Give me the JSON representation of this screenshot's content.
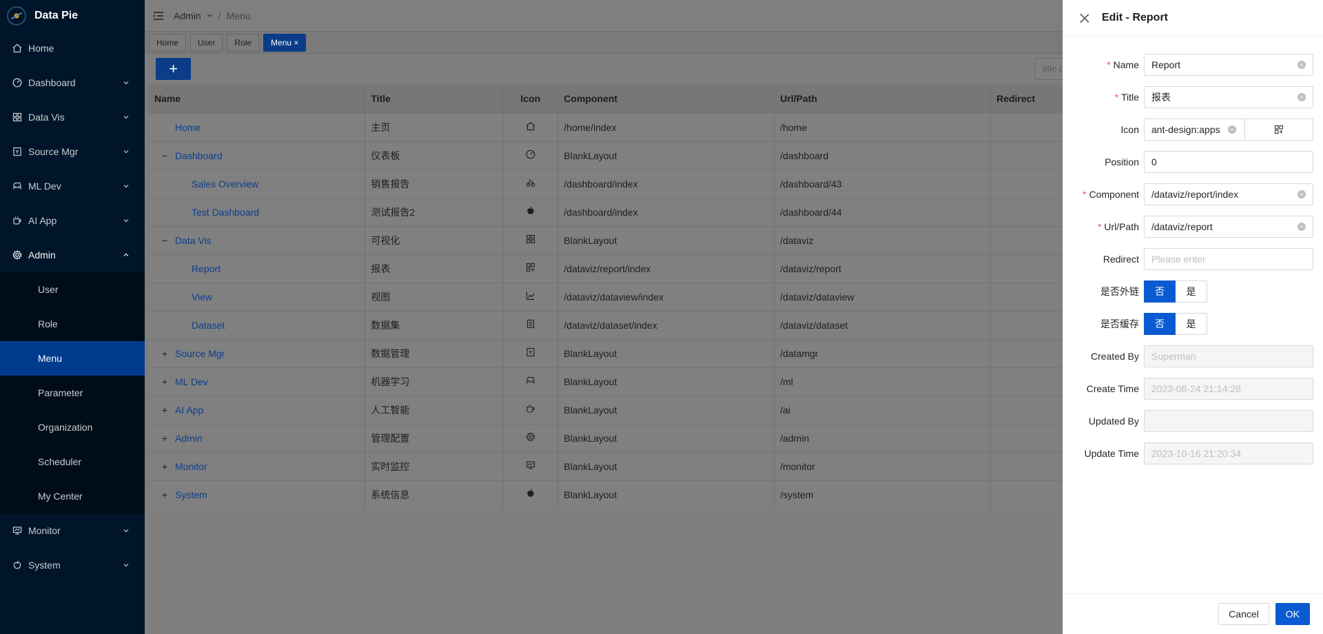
{
  "app": {
    "name": "Data Pie"
  },
  "sidebar": {
    "items": [
      {
        "label": "Home",
        "icon": "home-icon"
      },
      {
        "label": "Dashboard",
        "icon": "dashboard-icon"
      },
      {
        "label": "Data Vis",
        "icon": "grid-icon"
      },
      {
        "label": "Source Mgr",
        "icon": "database-icon"
      },
      {
        "label": "ML Dev",
        "icon": "car-icon"
      },
      {
        "label": "AI App",
        "icon": "cup-icon"
      },
      {
        "label": "Admin",
        "icon": "gear-icon"
      },
      {
        "label": "Monitor",
        "icon": "monitor-icon"
      },
      {
        "label": "System",
        "icon": "apple-icon"
      }
    ],
    "admin_sub": [
      "User",
      "Role",
      "Menu",
      "Parameter",
      "Organization",
      "Scheduler",
      "My Center"
    ]
  },
  "breadcrumb": {
    "first": "Admin",
    "sep": "/",
    "last": "Menu"
  },
  "tabs": [
    "Home",
    "User",
    "Role",
    "Menu ×"
  ],
  "toolbar": {
    "add_label": "+",
    "search_placeholder": "title o"
  },
  "table": {
    "columns": [
      "Name",
      "Title",
      "Icon",
      "Component",
      "Url/Path",
      "Redirect"
    ],
    "rows": [
      {
        "expander": "",
        "level": 0,
        "name": "Home",
        "title": "主页",
        "icon": "home-icon",
        "component": "/home/index",
        "path": "/home"
      },
      {
        "expander": "−",
        "level": 0,
        "name": "Dashboard",
        "title": "仪表板",
        "icon": "dashboard-icon",
        "component": "BlankLayout",
        "path": "/dashboard"
      },
      {
        "expander": "",
        "level": 1,
        "name": "Sales Overview",
        "title": "销售报告",
        "icon": "bike-icon",
        "component": "/dashboard/index",
        "path": "/dashboard/43"
      },
      {
        "expander": "",
        "level": 1,
        "name": "Test Dashboard",
        "title": "测试报告2",
        "icon": "apple-icon",
        "component": "/dashboard/index",
        "path": "/dashboard/44"
      },
      {
        "expander": "−",
        "level": 0,
        "name": "Data Vis",
        "title": "可视化",
        "icon": "grid-icon",
        "component": "BlankLayout",
        "path": "/dataviz"
      },
      {
        "expander": "",
        "level": 1,
        "name": "Report",
        "title": "报表",
        "icon": "apps-icon",
        "component": "/dataviz/report/index",
        "path": "/dataviz/report"
      },
      {
        "expander": "",
        "level": 1,
        "name": "View",
        "title": "视图",
        "icon": "line-chart-icon",
        "component": "/dataviz/dataview/index",
        "path": "/dataviz/dataview"
      },
      {
        "expander": "",
        "level": 1,
        "name": "Dataset",
        "title": "数据集",
        "icon": "document-icon",
        "component": "/dataviz/dataset/index",
        "path": "/dataviz/dataset"
      },
      {
        "expander": "+",
        "level": 0,
        "name": "Source Mgr",
        "title": "数据管理",
        "icon": "database-icon",
        "component": "BlankLayout",
        "path": "/datamgr"
      },
      {
        "expander": "+",
        "level": 0,
        "name": "ML Dev",
        "title": "机器学习",
        "icon": "car-icon",
        "component": "BlankLayout",
        "path": "/ml"
      },
      {
        "expander": "+",
        "level": 0,
        "name": "AI App",
        "title": "人工智能",
        "icon": "cup-icon",
        "component": "BlankLayout",
        "path": "/ai"
      },
      {
        "expander": "+",
        "level": 0,
        "name": "Admin",
        "title": "管理配置",
        "icon": "gear-icon",
        "component": "BlankLayout",
        "path": "/admin"
      },
      {
        "expander": "+",
        "level": 0,
        "name": "Monitor",
        "title": "实时监控",
        "icon": "monitor-icon",
        "component": "BlankLayout",
        "path": "/monitor"
      },
      {
        "expander": "+",
        "level": 0,
        "name": "System",
        "title": "系统信息",
        "icon": "apple-icon",
        "component": "BlankLayout",
        "path": "/system"
      }
    ]
  },
  "drawer": {
    "title": "Edit - Report",
    "fields": {
      "name": {
        "label": "Name",
        "value": "Report"
      },
      "title": {
        "label": "Title",
        "value": "报表"
      },
      "icon": {
        "label": "Icon",
        "value": "ant-design:apps"
      },
      "position": {
        "label": "Position",
        "value": "0"
      },
      "component": {
        "label": "Component",
        "value": "/dataviz/report/index"
      },
      "path": {
        "label": "Url/Path",
        "value": "/dataviz/report"
      },
      "redirect": {
        "label": "Redirect",
        "placeholder": "Please enter"
      },
      "external": {
        "label": "是否外链",
        "options": [
          "否",
          "是"
        ]
      },
      "cache": {
        "label": "是否缓存",
        "options": [
          "否",
          "是"
        ]
      },
      "created_by": {
        "label": "Created By",
        "value": "Superman"
      },
      "create_time": {
        "label": "Create Time",
        "value": "2023-08-24 21:14:28"
      },
      "updated_by": {
        "label": "Updated By",
        "value": ""
      },
      "update_time": {
        "label": "Update Time",
        "value": "2023-10-16 21:20:34"
      }
    },
    "required_mark": "*",
    "cancel_label": "Cancel",
    "ok_label": "OK"
  },
  "colors": {
    "sidebar_bg": "#001529",
    "active_menu": "#003a8c",
    "primary": "#0a5bd1",
    "link": "#0b3f8c"
  }
}
